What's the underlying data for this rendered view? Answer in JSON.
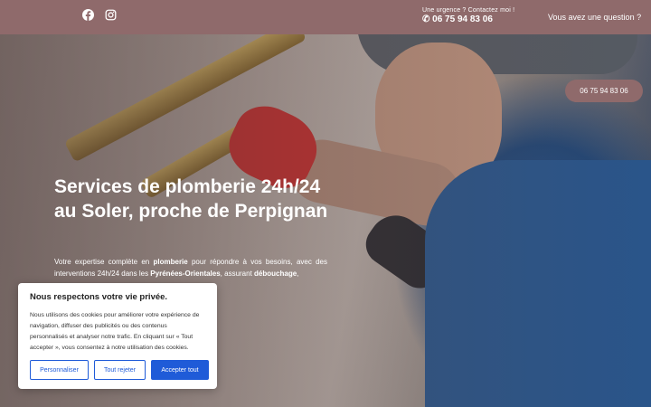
{
  "topbar": {
    "social": [
      {
        "icon": "facebook-icon"
      },
      {
        "icon": "instagram-icon"
      }
    ],
    "urgence_label": "Une urgence ? Contactez moi !",
    "urgence_phone": "✆ 06 75 94 83 06",
    "question_label": "Vous avez une question ?"
  },
  "hero": {
    "cta_phone": "06 75 94 83 06",
    "title": "Services de plomberie 24h/24 au Soler, proche de Perpignan",
    "desc_1": "Votre expertise complète en ",
    "desc_b1": "plomberie",
    "desc_2": " pour répondre à vos besoins, avec des interventions 24h/24 dans les ",
    "desc_b2": "Pyrénées-Orientales",
    "desc_3": ", assurant ",
    "desc_b3": "débouchage",
    "desc_4": ","
  },
  "cookie": {
    "title": "Nous respectons votre vie privée.",
    "text": "Nous utilisons des cookies pour améliorer votre expérience de navigation, diffuser des publicités ou des contenus personnalisés et analyser notre trafic. En cliquant sur « Tout accepter », vous consentez à notre utilisation des cookies.",
    "btn_customize": "Personnaliser",
    "btn_reject": "Tout rejeter",
    "btn_accept": "Accepter tout"
  },
  "colors": {
    "brand": "#8f6a6b",
    "accent": "#1f5bd8"
  }
}
